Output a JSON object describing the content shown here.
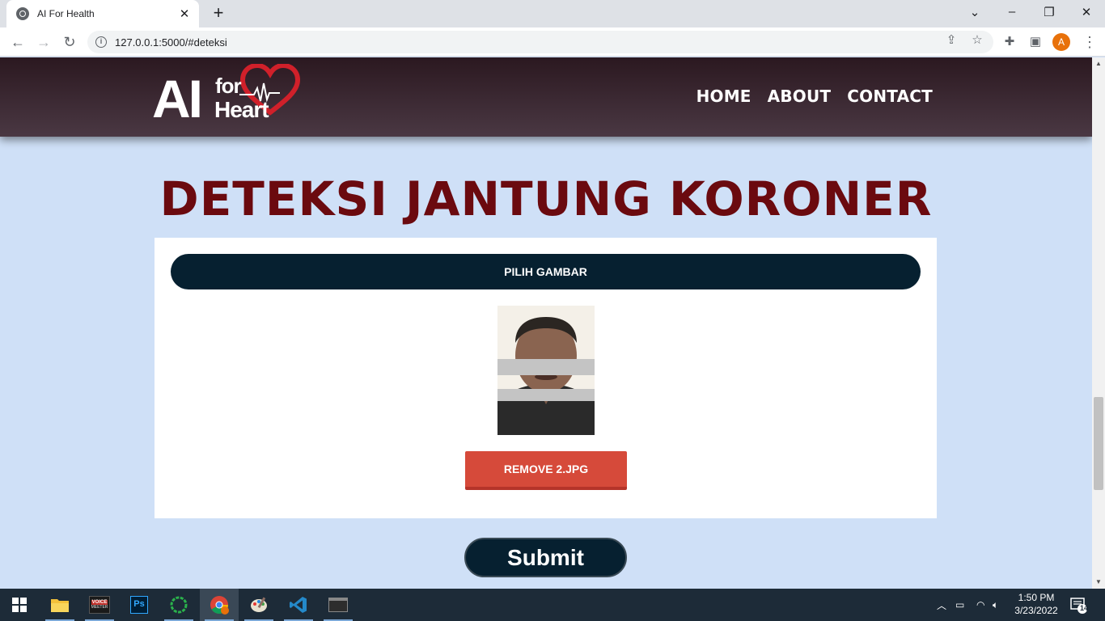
{
  "browser": {
    "tab_title": "AI For Health",
    "tab_close": "✕",
    "new_tab": "+",
    "url": "127.0.0.1:5000/#deteksi",
    "profile_initial": "A"
  },
  "header": {
    "logo_ai": "AI",
    "logo_for": "for",
    "logo_heart": "Heart",
    "nav": [
      "HOME",
      "ABOUT",
      "CONTACT"
    ],
    "logo_accent_color": "#d0202a"
  },
  "main": {
    "title": "DETEKSI JANTUNG KORONER",
    "pick_button": "PILIH GAMBAR",
    "remove_button": "REMOVE 2.JPG",
    "submit_button": "Submit"
  },
  "taskbar": {
    "apps": [
      "windows-start",
      "file-explorer",
      "voicemeeter",
      "photoshop",
      "green-circle-app",
      "chrome",
      "paint",
      "vscode",
      "terminal"
    ],
    "voicemeeter_label": "VOICE",
    "voicemeeter_sub": "MEETER",
    "photoshop_label": "Ps",
    "time": "1:50 PM",
    "date": "3/23/2022",
    "notification_count": "14"
  }
}
